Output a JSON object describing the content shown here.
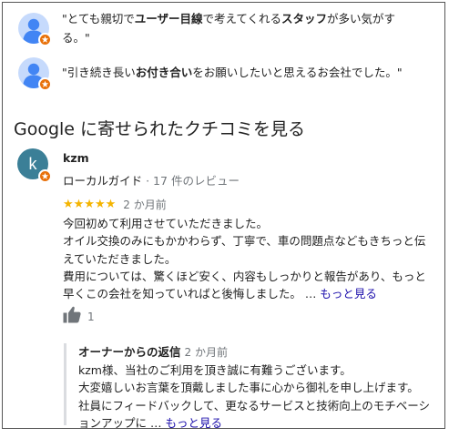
{
  "snippets": [
    {
      "parts": [
        {
          "text": "\"とても親切で",
          "bold": false
        },
        {
          "text": "ユーザー目線",
          "bold": true
        },
        {
          "text": "で考えてくれる",
          "bold": false
        },
        {
          "text": "スタッフ",
          "bold": true
        },
        {
          "text": "が多い気がする。\"",
          "bold": false
        }
      ]
    },
    {
      "parts": [
        {
          "text": "\"引き続き長い",
          "bold": false
        },
        {
          "text": "お付き合い",
          "bold": true
        },
        {
          "text": "をお願いしたいと思えるお会社でした。\"",
          "bold": false
        }
      ]
    }
  ],
  "section_title": "Google に寄せられたクチコミを見る",
  "review": {
    "avatar_letter": "k",
    "reviewer_name": "kzm",
    "reviewer_type": "ローカルガイド",
    "review_count": " · 17 件のレビュー",
    "stars": "★★★★★",
    "rating": 5,
    "time": "2 か月前",
    "body_lines": [
      "今回初めて利用させていただきました。",
      "オイル交換のみにもかかわらず、丁寧で、車の問題点などもきちっと伝えていただきました。",
      "費用については、驚くほど安く、内容もしっかりと報告があり、もっと早くこの会社を知っていればと後悔しました。 … "
    ],
    "more_label": "もっと見る",
    "like_count": "1"
  },
  "owner_reply": {
    "label": "オーナーからの返信",
    "time": "2 か月前",
    "body": "kzm様、当社のご利用を頂き誠に有難うございます。\n大変嬉しいお言葉を頂戴しました事に心から御礼を申し上げます。\n社員にフィードバックして、更なるサービスと技術向上のモチベーションアップに … ",
    "more_label": "もっと見る"
  },
  "colors": {
    "badge": "#e8710a",
    "avatar_bg": "#3b7f97",
    "star": "#f4b400",
    "link": "#1a0dab"
  },
  "icons": {
    "local_guide_badge": "local-guide-badge-icon",
    "thumbs_up": "thumbs-up-icon",
    "default_avatar": "default-person-avatar"
  }
}
